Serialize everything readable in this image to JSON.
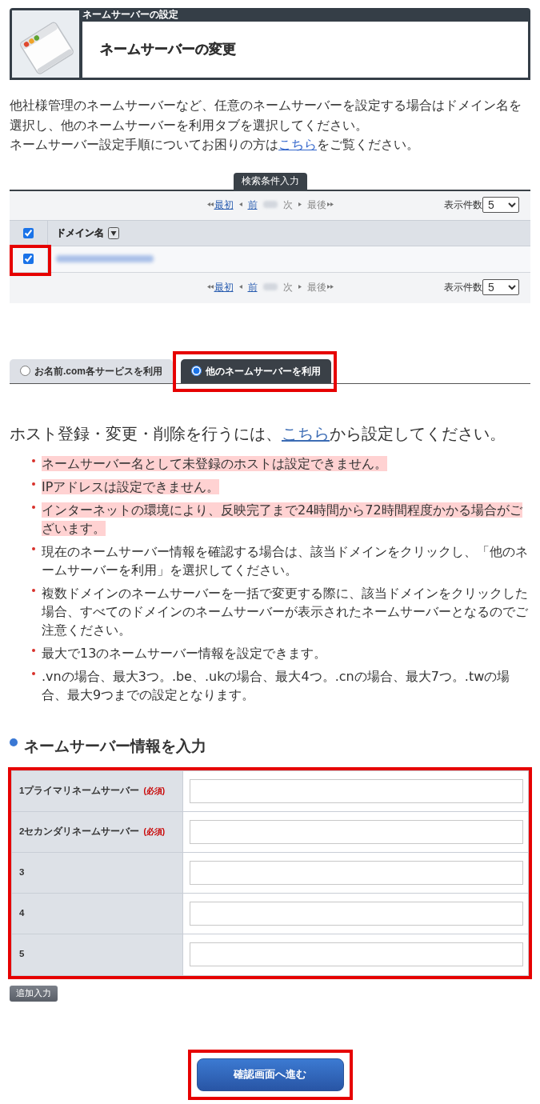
{
  "header": {
    "category": "ネームサーバーの設定",
    "title": "ネームサーバーの変更"
  },
  "intro": {
    "paragraph": "他社様管理のネームサーバーなど、任意のネームサーバーを設定する場合はドメイン名を選択し、他のネームサーバーを利用タブを選択してください。",
    "help": {
      "before": "ネームサーバー設定手順についてお困りの方は",
      "link": "こちら",
      "after": "をご覧ください。"
    }
  },
  "search_tab": {
    "label": "検索条件入力"
  },
  "domain_table": {
    "pagination_top": {
      "controls": [
        {
          "kind": "first",
          "label": "最初",
          "enabled": true
        },
        {
          "kind": "prev",
          "label": "前",
          "enabled": true
        },
        {
          "kind": "next",
          "label": "次",
          "enabled": false
        },
        {
          "kind": "last",
          "label": "最後",
          "enabled": false
        }
      ],
      "per_page_label": "表示件数",
      "per_page": "5"
    },
    "header": {
      "checked": true,
      "column": "ドメイン名"
    },
    "rows": [
      {
        "checked": true,
        "highlighted": true
      }
    ],
    "pagination_bottom": {
      "controls": [
        {
          "kind": "first",
          "label": "最初",
          "enabled": true
        },
        {
          "kind": "prev",
          "label": "前",
          "enabled": true
        },
        {
          "kind": "next",
          "label": "次",
          "enabled": false
        },
        {
          "kind": "last",
          "label": "最後",
          "enabled": false
        }
      ],
      "per_page_label": "表示件数",
      "per_page": "5"
    }
  },
  "service_tabs": [
    {
      "label": "お名前.com各サービスを利用",
      "selected": false,
      "highlighted": false
    },
    {
      "label": "他のネームサーバーを利用",
      "selected": true,
      "highlighted": true
    }
  ],
  "host_notice": {
    "before": "ホスト登録・変更・削除を行うには、",
    "link": "こちら",
    "after": "から設定してください。"
  },
  "notes": [
    {
      "text": "ネームサーバー名として未登録のホストは設定できません。",
      "emphasized": true
    },
    {
      "text": "IPアドレスは設定できません。",
      "emphasized": true
    },
    {
      "text": "インターネットの環境により、反映完了まで24時間から72時間程度かかる場合がございます。",
      "emphasized": true
    },
    {
      "text": "現在のネームサーバー情報を確認する場合は、該当ドメインをクリックし、「他のネームサーバーを利用」を選択してください。",
      "emphasized": false
    },
    {
      "text": "複数ドメインのネームサーバーを一括で変更する際に、該当ドメインをクリックした場合、すべてのドメインのネームサーバーが表示されたネームサーバーとなるのでご注意ください。",
      "emphasized": false
    },
    {
      "text": "最大で13のネームサーバー情報を設定できます。",
      "emphasized": false
    },
    {
      "text": ".vnの場合、最大3つ。.be、.ukの場合、最大4つ。.cnの場合、最大7つ。.twの場合、最大9つまでの設定となります。",
      "emphasized": false
    }
  ],
  "nameserver_form": {
    "heading": "ネームサーバー情報を入力",
    "highlighted": true,
    "rows": [
      {
        "label": "1プライマリネームサーバー",
        "required_mark": "(必須)"
      },
      {
        "label": "2セカンダリネームサーバー",
        "required_mark": "(必須)"
      },
      {
        "label": "3"
      },
      {
        "label": "4"
      },
      {
        "label": "5"
      }
    ],
    "add_button": "追加入力"
  },
  "confirm_button": {
    "label": "確認画面へ進む",
    "highlighted": true
  }
}
